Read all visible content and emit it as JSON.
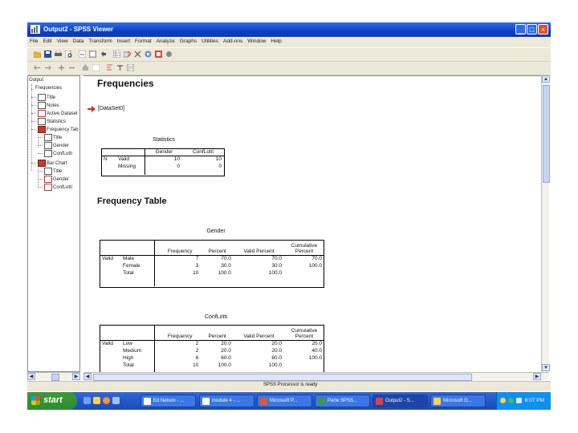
{
  "window": {
    "title": "Output2 - SPSS Viewer"
  },
  "menu": [
    "File",
    "Edit",
    "View",
    "Data",
    "Transform",
    "Insert",
    "Format",
    "Analyze",
    "Graphs",
    "Utilities",
    "Add-ons",
    "Window",
    "Help"
  ],
  "outline": {
    "items": [
      {
        "label": "Output",
        "level": 0
      },
      {
        "label": "Frequencies",
        "level": 1
      },
      {
        "label": "Title",
        "level": 2
      },
      {
        "label": "Notes",
        "level": 2
      },
      {
        "label": "Active Dataset",
        "level": 2
      },
      {
        "label": "Statistics",
        "level": 2
      },
      {
        "label": "Frequency Tab",
        "level": 2
      },
      {
        "label": "Title",
        "level": 3
      },
      {
        "label": "Gender",
        "level": 3
      },
      {
        "label": "ConfLotti",
        "level": 3
      },
      {
        "label": "Bar Chart",
        "level": 2
      },
      {
        "label": "Title",
        "level": 3
      },
      {
        "label": "Gender",
        "level": 3
      },
      {
        "label": "ConfLotti",
        "level": 3
      }
    ]
  },
  "content": {
    "heading": "Frequencies",
    "dataset": "[DataSet0]",
    "statistics": {
      "title": "Statistics",
      "col_gender": "Gender",
      "col_conf": "ConfLotti",
      "n_label": "N",
      "valid_label": "Valid",
      "missing_label": "Missing",
      "valid_gender": "10",
      "valid_conf": "10",
      "missing_gender": "0",
      "missing_conf": "0"
    },
    "freq_heading": "Frequency Table",
    "gender_table": {
      "title": "Gender",
      "headers": [
        "Frequency",
        "Percent",
        "Valid Percent",
        "Cumulative Percent"
      ],
      "valid_label": "Valid",
      "rows": [
        {
          "label": "Male",
          "freq": "7",
          "pct": "70.0",
          "vpct": "70.0",
          "cpct": "70.0"
        },
        {
          "label": "Female",
          "freq": "3",
          "pct": "30.0",
          "vpct": "30.0",
          "cpct": "100.0"
        },
        {
          "label": "Total",
          "freq": "10",
          "pct": "100.0",
          "vpct": "100.0",
          "cpct": ""
        }
      ]
    },
    "conf_table": {
      "title": "ConfLotti",
      "headers": [
        "Frequency",
        "Percent",
        "Valid Percent",
        "Cumulative Percent"
      ],
      "valid_label": "Valid",
      "rows": [
        {
          "label": "Low",
          "freq": "2",
          "pct": "20.0",
          "vpct": "20.0",
          "cpct": "20.0"
        },
        {
          "label": "Medium",
          "freq": "2",
          "pct": "20.0",
          "vpct": "20.0",
          "cpct": "40.0"
        },
        {
          "label": "High",
          "freq": "6",
          "pct": "60.0",
          "vpct": "60.0",
          "cpct": "100.0"
        },
        {
          "label": "Total",
          "freq": "10",
          "pct": "100.0",
          "vpct": "100.0",
          "cpct": ""
        }
      ]
    }
  },
  "status": {
    "text": "SPSS Processor is ready"
  },
  "taskbar": {
    "start": "start",
    "tasks": [
      {
        "label": "Ed Nelson - ...",
        "active": false
      },
      {
        "label": "module 4 - ...",
        "active": false
      },
      {
        "label": "Microsoft P...",
        "active": false
      },
      {
        "label": "Parte SPSS...",
        "active": false
      },
      {
        "label": "Output2 - S...",
        "active": true
      },
      {
        "label": "Microsoft O...",
        "active": false
      }
    ],
    "clock": "8:07 PM"
  },
  "colors": {
    "titlebar": "#0a3fc6",
    "menubar": "#ece9d8",
    "taskbar": "#2457c8",
    "start": "#2e8b2e",
    "arrow": "#d42a1a"
  }
}
